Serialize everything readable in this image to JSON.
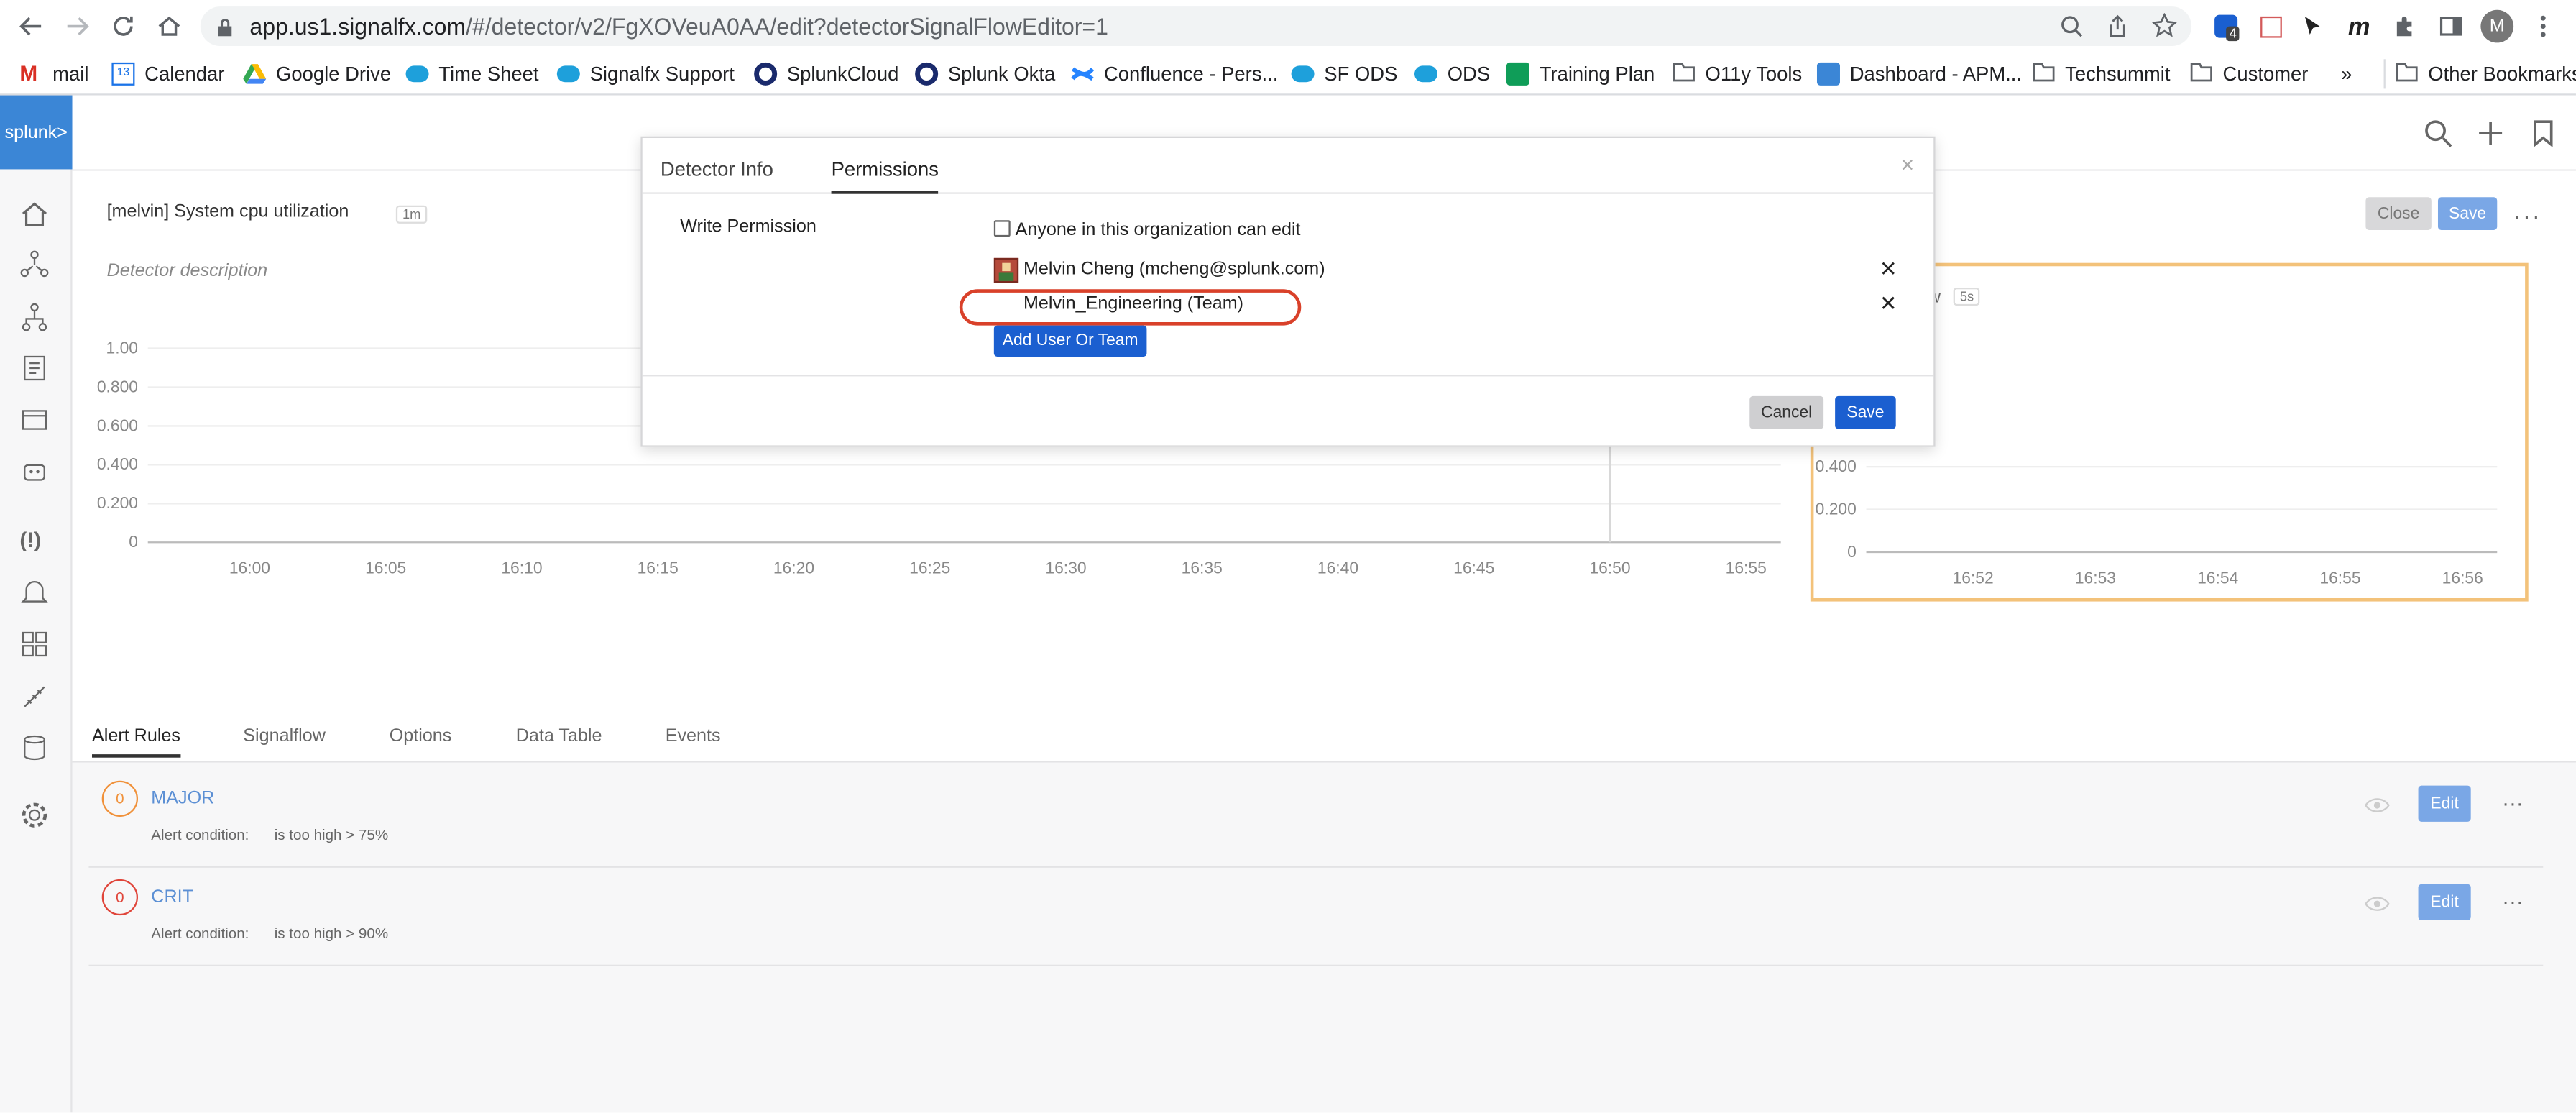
{
  "browser": {
    "url_host": "app.us1.signalfx.com",
    "url_path": "/#/detector/v2/FgXOVeuA0AA/edit?detectorSignalFlowEditor=1",
    "profile_initial": "M",
    "ext_badge": "4",
    "bookmarks": [
      "mail",
      "Calendar",
      "Google Drive",
      "Time Sheet",
      "Signalfx Support",
      "SplunkCloud",
      "Splunk Okta",
      "Confluence - Pers...",
      "SF ODS",
      "ODS",
      "Training Plan",
      "O11y Tools",
      "Dashboard - APM...",
      "Techsummit",
      "Customer"
    ],
    "bookmarks_overflow": "»",
    "other_bookmarks": "Other Bookmarks",
    "calendar_num": "13"
  },
  "app": {
    "logo": "splunk>",
    "detector_title": "[melvin] System cpu utilization",
    "resolution": "1m",
    "description_placeholder": "Detector description",
    "close_label": "Close",
    "save_label": "Save",
    "preview_res": "5s",
    "preview_title_fragment": "w"
  },
  "chart_data": [
    {
      "type": "line",
      "x": [
        "16:00",
        "16:05",
        "16:10",
        "16:15",
        "16:20",
        "16:25",
        "16:30",
        "16:35",
        "16:40",
        "16:45",
        "16:50",
        "16:55"
      ],
      "yticks": [
        "1.00",
        "0.800",
        "0.600",
        "0.400",
        "0.200",
        "0"
      ],
      "ylim": [
        0,
        1
      ],
      "series": []
    },
    {
      "type": "line",
      "x": [
        "16:52",
        "16:53",
        "16:54",
        "16:55",
        "16:56"
      ],
      "yticks": [
        "0.400",
        "0.200",
        "0"
      ],
      "series": []
    }
  ],
  "tabs": [
    "Alert Rules",
    "Signalflow",
    "Options",
    "Data Table",
    "Events"
  ],
  "rules": [
    {
      "count": "0",
      "name": "MAJOR",
      "cond_label": "Alert condition:",
      "cond": "is too high > 75%",
      "color": "#f0913a",
      "edit": "Edit"
    },
    {
      "count": "0",
      "name": "CRIT",
      "cond_label": "Alert condition:",
      "cond": "is too high > 90%",
      "color": "#e0453a",
      "edit": "Edit"
    }
  ],
  "dialog": {
    "tab_info": "Detector Info",
    "tab_permissions": "Permissions",
    "write_permission": "Write Permission",
    "anyone_label": "Anyone in this organization can edit",
    "anyone_checked": false,
    "entries": [
      {
        "label": "Melvin Cheng (mcheng@splunk.com)",
        "type": "user"
      },
      {
        "label": "Melvin_Engineering (Team)",
        "type": "team"
      }
    ],
    "add_label": "Add User Or Team",
    "cancel_label": "Cancel",
    "save_label": "Save",
    "highlight_color": "#d9412a"
  }
}
